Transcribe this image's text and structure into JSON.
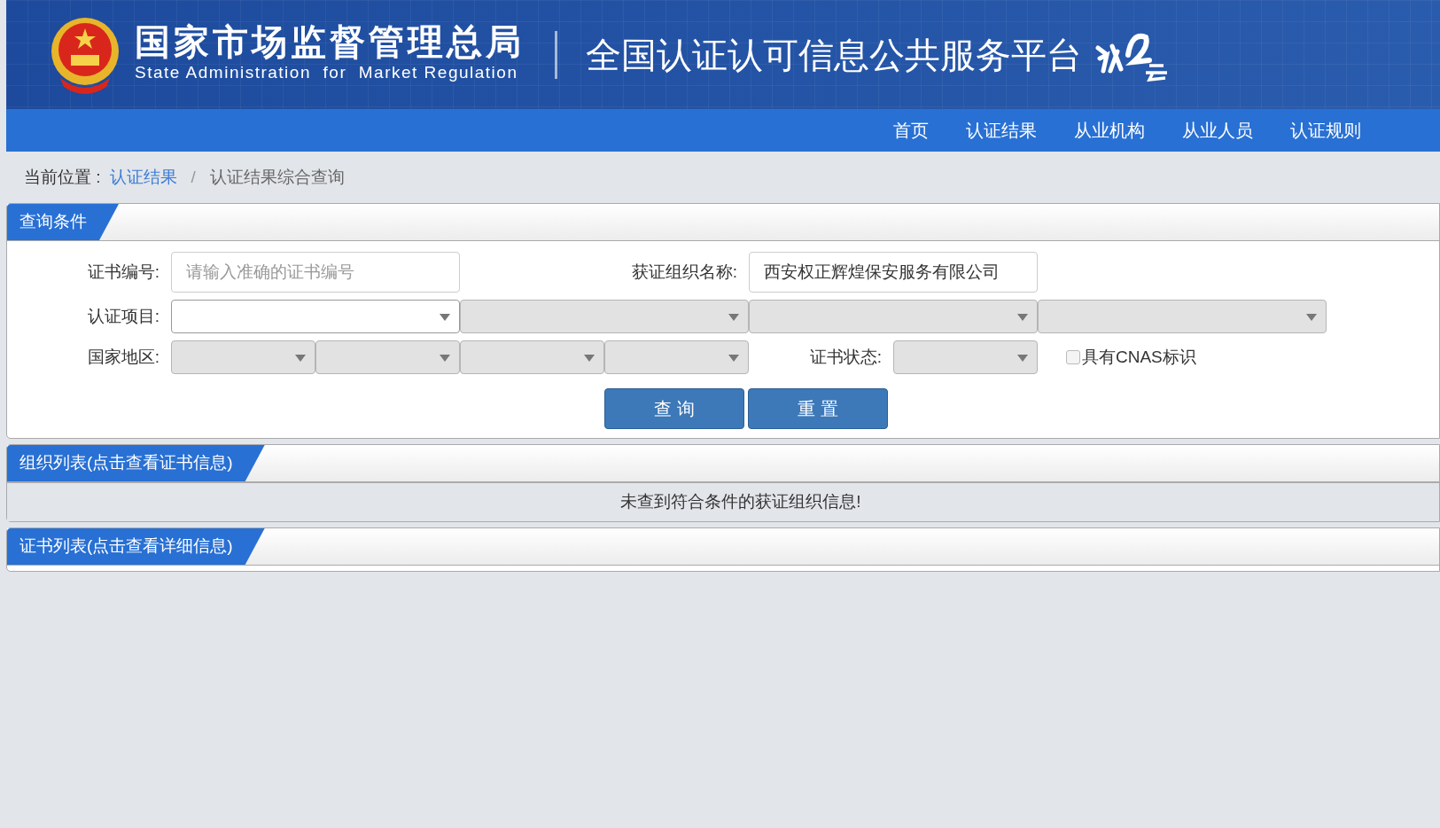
{
  "header": {
    "agency_name": "国家市场监督管理总局",
    "agency_name_en": "State Administration  for  Market Regulation",
    "platform_name": "全国认证认可信息公共服务平台"
  },
  "nav": [
    {
      "label": "首页",
      "selected": false
    },
    {
      "label": "认证结果",
      "selected": false
    },
    {
      "label": "从业机构",
      "selected": false
    },
    {
      "label": "从业人员",
      "selected": false
    },
    {
      "label": "认证规则",
      "selected": false
    }
  ],
  "breadcrumb": {
    "prefix": "当前位置 :",
    "separator": "/",
    "items": [
      {
        "label": "认证结果",
        "kind": "link"
      },
      {
        "label": "认证结果综合查询",
        "kind": "current"
      }
    ]
  },
  "query_panel": {
    "title": "查询条件",
    "rows": [
      [
        {
          "kind": "label",
          "text": "证书编号:"
        },
        {
          "kind": "input",
          "placeholder": "请输入准确的证书编号"
        },
        {
          "kind": "label",
          "text": "获证组织名称:"
        },
        {
          "kind": "input",
          "value": "西安权正辉煌保安服务有限公司"
        }
      ],
      [
        {
          "kind": "label",
          "text": "认证项目:"
        },
        {
          "kind": "select",
          "disabled": false
        },
        {
          "kind": "select",
          "disabled": true
        },
        {
          "kind": "select",
          "disabled": true
        },
        {
          "kind": "select",
          "disabled": true
        }
      ],
      [
        {
          "kind": "label",
          "text": "国家地区:"
        },
        {
          "kind": "select",
          "disabled": true
        },
        {
          "kind": "select",
          "disabled": true
        },
        {
          "kind": "select",
          "disabled": true
        },
        {
          "kind": "select",
          "disabled": true
        },
        {
          "kind": "label",
          "text": "证书状态:"
        },
        {
          "kind": "select",
          "disabled": true
        },
        {
          "kind": "checkbox",
          "label": "具有CNAS标识",
          "checked": false
        }
      ]
    ],
    "buttons": [
      "查 询",
      "重 置"
    ]
  },
  "org_panel": {
    "title": "组织列表(点击查看证书信息)",
    "empty_message": "未查到符合条件的获证组织信息!"
  },
  "cert_panel": {
    "title": "证书列表(点击查看详细信息)"
  }
}
